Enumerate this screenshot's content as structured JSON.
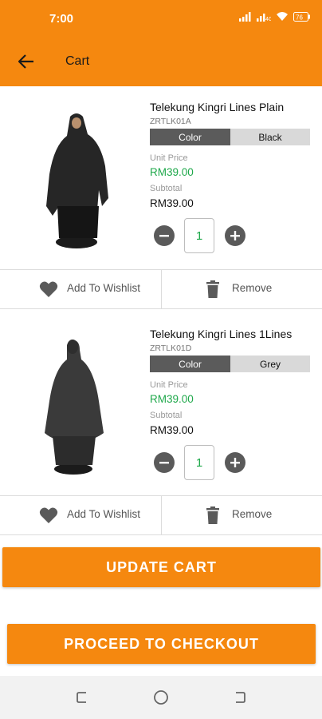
{
  "status_bar": {
    "time": "7:00",
    "battery": "76"
  },
  "header": {
    "title": "Cart",
    "back_icon": "arrow-left-icon"
  },
  "items": [
    {
      "name": "Telekung Kingri Lines Plain",
      "sku": "ZRTLK01A",
      "variant_label": "Color",
      "variant_value": "Black",
      "unit_price_label": "Unit Price",
      "unit_price": "RM39.00",
      "subtotal_label": "Subtotal",
      "subtotal": "RM39.00",
      "quantity": "1",
      "wishlist_label": "Add To Wishlist",
      "remove_label": "Remove"
    },
    {
      "name": "Telekung Kingri Lines 1Lines",
      "sku": "ZRTLK01D",
      "variant_label": "Color",
      "variant_value": "Grey",
      "unit_price_label": "Unit Price",
      "unit_price": "RM39.00",
      "subtotal_label": "Subtotal",
      "subtotal": "RM39.00",
      "quantity": "1",
      "wishlist_label": "Add To Wishlist",
      "remove_label": "Remove"
    }
  ],
  "buttons": {
    "update_cart": "UPDATE CART",
    "checkout": "PROCEED TO CHECKOUT"
  },
  "colors": {
    "accent": "#F5880F",
    "price_green": "#1ea84a",
    "variant_dark": "#5b5b5b",
    "variant_light": "#d9d9d9"
  },
  "icons": {
    "minus": "minus-circle-icon",
    "plus": "plus-circle-icon",
    "wishlist": "heart-icon",
    "remove": "trash-icon",
    "nav_recent": "recent-apps-icon",
    "nav_home": "home-circle-icon",
    "nav_back": "back-nav-icon"
  }
}
